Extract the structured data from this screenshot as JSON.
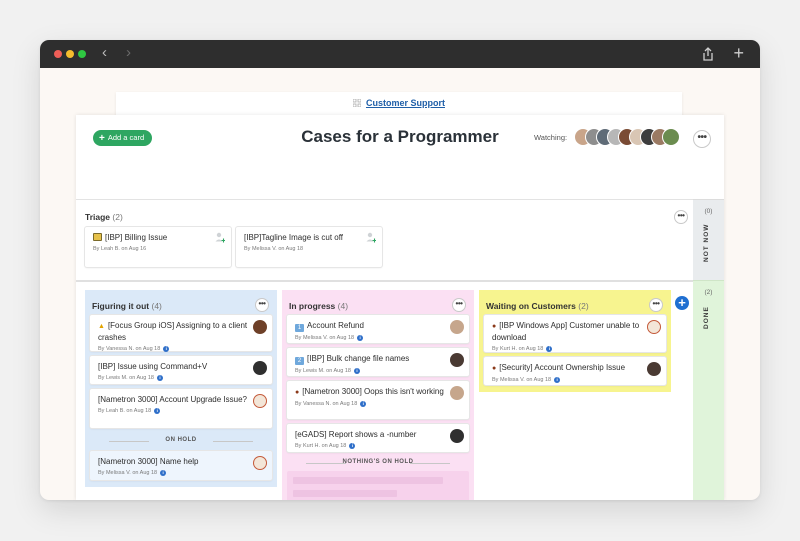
{
  "browser": {
    "back_glyph": "‹",
    "forward_glyph": "›",
    "new_tab_glyph": "+"
  },
  "breadcrumb": {
    "label": "Customer Support"
  },
  "board": {
    "title": "Cases for a Programmer",
    "add_card_label": "Add a card",
    "watching_label": "Watching:",
    "menu_glyph": "•••"
  },
  "triage": {
    "title": "Triage",
    "count": "(2)",
    "cards": [
      {
        "title": "[IBP] Billing Issue",
        "meta": "By Leah B. on Aug 16"
      },
      {
        "title": "[IBP]Tagline Image is cut off",
        "meta": "By Melissa V. on Aug 18"
      }
    ]
  },
  "side": {
    "not_now": {
      "count": "(0)",
      "label": "NOT NOW"
    },
    "done": {
      "count": "(2)",
      "label": "DONE"
    }
  },
  "columns": [
    {
      "title": "Figuring it out",
      "count": "(4)",
      "color": "#dbe9f8",
      "cards": [
        {
          "title": "[Focus Group iOS] Assigning to a client crashes",
          "meta": "By Vanessa N. on Aug 18"
        },
        {
          "title": "[IBP] Issue using Command+V",
          "meta": "By Lewis M. on Aug 18"
        },
        {
          "title": "[Nametron 3000] Account Upgrade Issue?",
          "meta": "By Leah B. on Aug 18"
        }
      ],
      "hold_label": "ON HOLD",
      "hold_cards": [
        {
          "title": "[Nametron 3000] Name help",
          "meta": "By Melissa V. on Aug 18"
        }
      ]
    },
    {
      "title": "In progress",
      "count": "(4)",
      "color": "#fbe0f3",
      "cards": [
        {
          "title": "Account Refund",
          "meta": "By Melissa V. on Aug 18",
          "badge": "1"
        },
        {
          "title": "[IBP] Bulk change file names",
          "meta": "By Lewis M. on Aug 18",
          "badge": "2"
        },
        {
          "title": "[Nametron 3000] Oops this isn't working",
          "meta": "By Vanessa N. on Aug 18"
        },
        {
          "title": "[eGADS] Report shows a -number",
          "meta": "By Kurt H. on Aug 18"
        }
      ],
      "hold_label": "NOTHING'S ON HOLD"
    },
    {
      "title": "Waiting on Customers",
      "count": "(2)",
      "color": "#f7f48f",
      "cards": [
        {
          "title": "[IBP Windows App] Customer unable to download",
          "meta": "By Kurt H. on Aug 18"
        },
        {
          "title": "[Security] Account Ownership Issue",
          "meta": "By Melissa V. on Aug 18"
        }
      ]
    }
  ],
  "icons": {
    "info": "i",
    "add_column": "+"
  },
  "colors": {
    "accent_green": "#2ea661",
    "accent_blue": "#1f6fd1",
    "done_green": "#e0f4da"
  }
}
